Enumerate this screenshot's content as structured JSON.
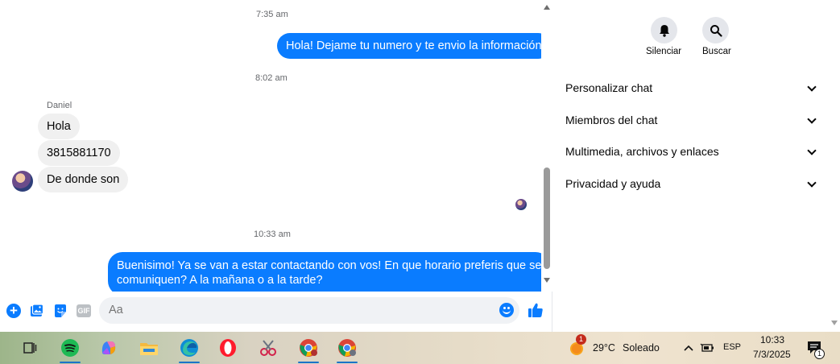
{
  "chat": {
    "timestamps": [
      "7:35 am",
      "8:02 am",
      "10:33 am"
    ],
    "messages": [
      {
        "text": "Hola! Dejame tu numero y te envio la información"
      },
      {
        "text": "Hola"
      },
      {
        "text": "3815881170"
      },
      {
        "text": "De donde son"
      },
      {
        "line1": "Buenisimo! Ya se van a estar contactando con vos! En que horario preferis que se",
        "line2": "comuniquen? A la mañana o a la tarde?"
      }
    ],
    "sender_name": "Daniel"
  },
  "composer": {
    "placeholder": "Aa",
    "gif_label": "GIF"
  },
  "info": {
    "mute_label": "Silenciar",
    "search_label": "Buscar",
    "sections": [
      {
        "label": "Personalizar chat"
      },
      {
        "label": "Miembros del chat"
      },
      {
        "label": "Multimedia, archivos y enlaces"
      },
      {
        "label": "Privacidad y ayuda"
      }
    ]
  },
  "taskbar": {
    "weather_temp": "29°C",
    "weather_desc": "Soleado",
    "weather_badge": "1",
    "language": "ESP",
    "time": "10:33",
    "date": "7/3/2025",
    "notification_count": "1"
  },
  "colors": {
    "outgoing_bubble": "#0a7cff",
    "incoming_bubble": "#f0f0f0",
    "accent": "#0a7cff"
  }
}
